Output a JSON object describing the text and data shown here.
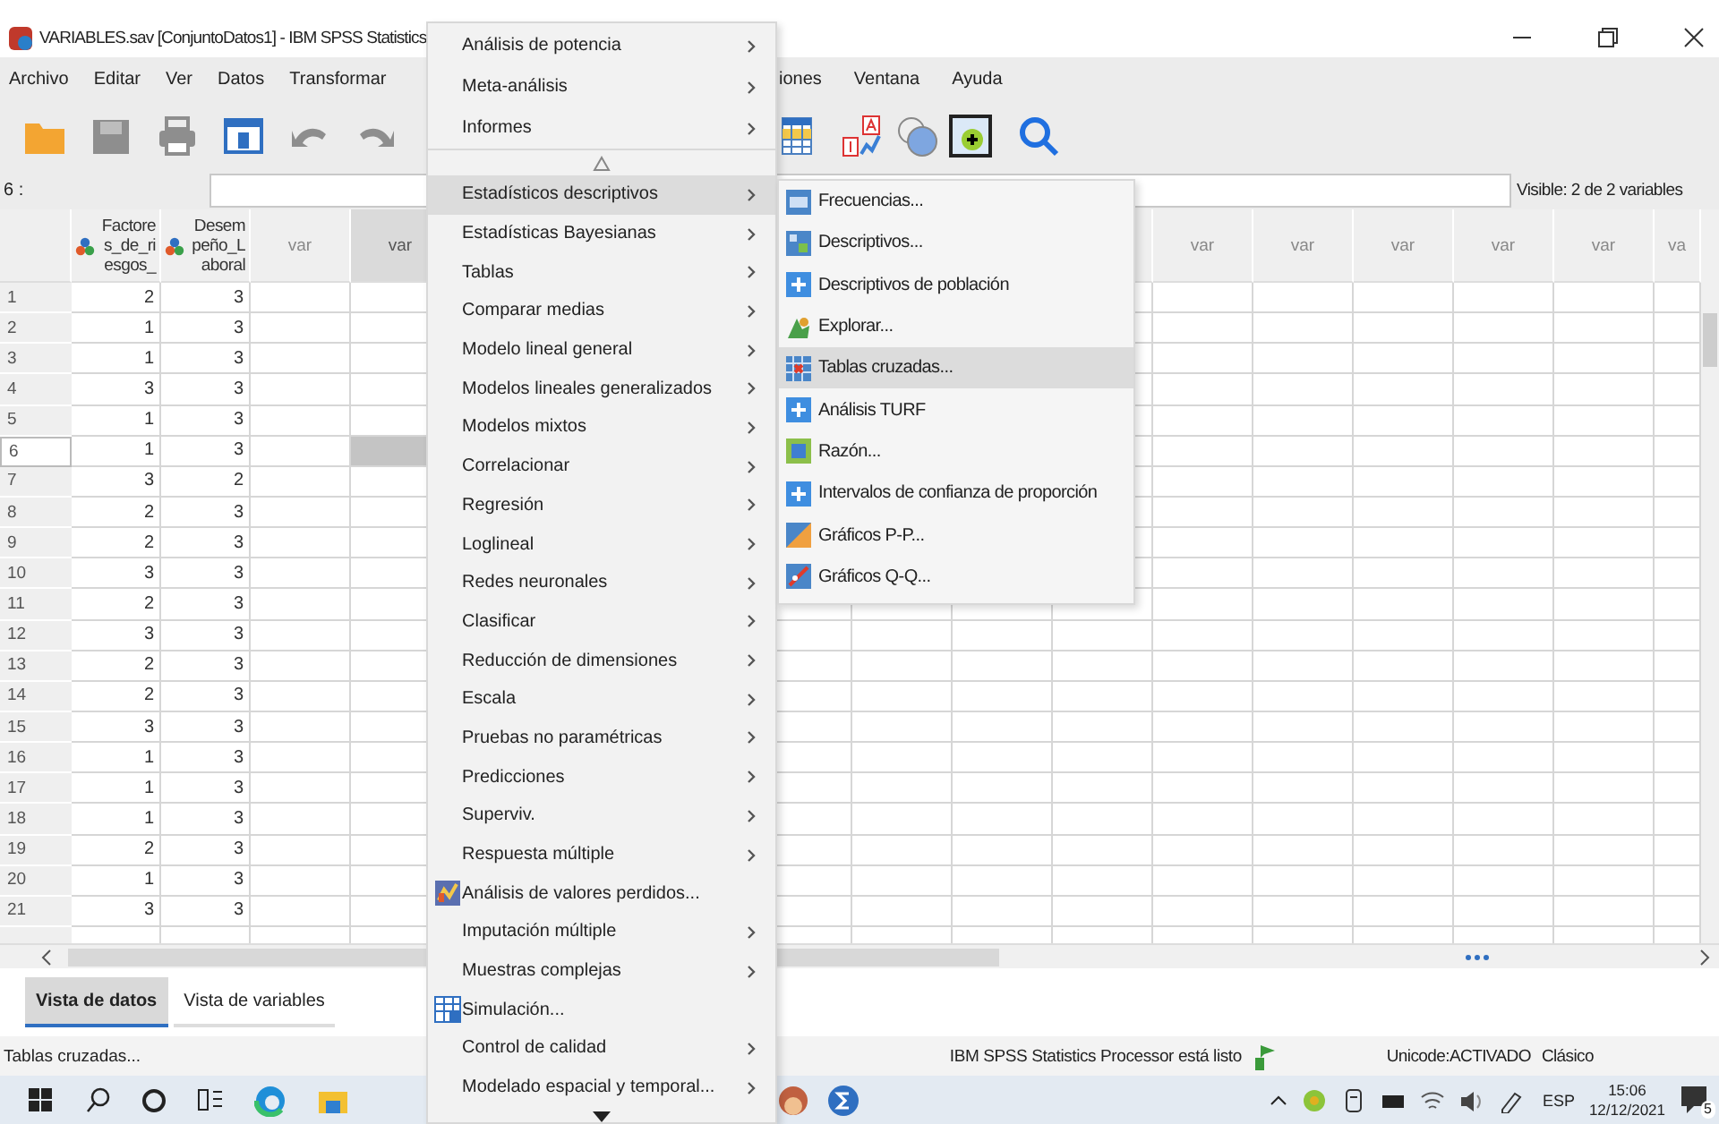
{
  "window": {
    "title": "VARIABLES.sav [ConjuntoDatos1] - IBM SPSS Statistics"
  },
  "menu_bar": {
    "left": [
      "Archivo",
      "Editar",
      "Ver",
      "Datos",
      "Transformar"
    ],
    "right": [
      "iones",
      "Ventana",
      "Ayuda"
    ]
  },
  "cell_editor": {
    "reference": "6 :",
    "visible": "Visible: 2 de 2 variables"
  },
  "table": {
    "columns": [
      {
        "label": "Factores_de_riesgos_",
        "kind": "nominal",
        "selected": false
      },
      {
        "label": "Desempeño_Laboral",
        "kind": "nominal",
        "selected": false
      },
      {
        "label": "var",
        "kind": "empty",
        "selected": false
      },
      {
        "label": "var",
        "kind": "empty",
        "selected": true
      },
      {
        "kind": "empty"
      },
      {
        "kind": "empty"
      },
      {
        "kind": "empty"
      },
      {
        "kind": "empty"
      },
      {
        "kind": "empty"
      },
      {
        "kind": "empty"
      },
      {
        "kind": "empty"
      },
      {
        "label": "var",
        "kind": "empty",
        "selected": false
      },
      {
        "label": "var",
        "kind": "empty",
        "selected": false
      },
      {
        "label": "var",
        "kind": "empty",
        "selected": false
      },
      {
        "label": "var",
        "kind": "empty",
        "selected": false
      },
      {
        "label": "var",
        "kind": "empty",
        "selected": false
      },
      {
        "label": "va",
        "kind": "empty",
        "selected": false
      }
    ],
    "rows": [
      {
        "number": "1",
        "values": [
          "2",
          "3"
        ],
        "selected": false
      },
      {
        "number": "2",
        "values": [
          "1",
          "3"
        ],
        "selected": false
      },
      {
        "number": "3",
        "values": [
          "1",
          "3"
        ],
        "selected": false
      },
      {
        "number": "4",
        "values": [
          "3",
          "3"
        ],
        "selected": false
      },
      {
        "number": "5",
        "values": [
          "1",
          "3"
        ],
        "selected": false
      },
      {
        "number": "6",
        "values": [
          "1",
          "3"
        ],
        "selected": true
      },
      {
        "number": "7",
        "values": [
          "3",
          "2"
        ],
        "selected": false
      },
      {
        "number": "8",
        "values": [
          "2",
          "3"
        ],
        "selected": false
      },
      {
        "number": "9",
        "values": [
          "2",
          "3"
        ],
        "selected": false
      },
      {
        "number": "10",
        "values": [
          "3",
          "3"
        ],
        "selected": false
      },
      {
        "number": "11",
        "values": [
          "2",
          "3"
        ],
        "selected": false
      },
      {
        "number": "12",
        "values": [
          "3",
          "3"
        ],
        "selected": false
      },
      {
        "number": "13",
        "values": [
          "2",
          "3"
        ],
        "selected": false
      },
      {
        "number": "14",
        "values": [
          "2",
          "3"
        ],
        "selected": false
      },
      {
        "number": "15",
        "values": [
          "3",
          "3"
        ],
        "selected": false
      },
      {
        "number": "16",
        "values": [
          "1",
          "3"
        ],
        "selected": false
      },
      {
        "number": "17",
        "values": [
          "1",
          "3"
        ],
        "selected": false
      },
      {
        "number": "18",
        "values": [
          "1",
          "3"
        ],
        "selected": false
      },
      {
        "number": "19",
        "values": [
          "2",
          "3"
        ],
        "selected": false
      },
      {
        "number": "20",
        "values": [
          "1",
          "3"
        ],
        "selected": false
      },
      {
        "number": "21",
        "values": [
          "3",
          "3"
        ],
        "selected": false
      }
    ]
  },
  "view_tabs": [
    {
      "label": "Vista de datos",
      "selected": true
    },
    {
      "label": "Vista de variables",
      "selected": false
    }
  ],
  "status_bar": {
    "message": "Tablas cruzadas...",
    "processor": "IBM SPSS Statistics Processor está listo",
    "encoding": "Unicode:ACTIVADO",
    "mode": "Clásico"
  },
  "menu": {
    "items": [
      {
        "label": "Análisis de potencia",
        "kind": "submenu",
        "selected": false
      },
      {
        "label": "Meta-análisis",
        "kind": "submenu",
        "selected": false
      },
      {
        "label": "Informes",
        "kind": "submenu",
        "selected": false
      },
      {
        "kind": "scroll-up",
        "selected": false
      },
      {
        "label": "Estadísticos descriptivos",
        "kind": "submenu",
        "selected": true
      },
      {
        "label": "Estadísticas Bayesianas",
        "kind": "submenu",
        "selected": false
      },
      {
        "label": "Tablas",
        "kind": "submenu",
        "selected": false
      },
      {
        "label": "Comparar medias",
        "kind": "submenu",
        "selected": false
      },
      {
        "label": "Modelo lineal general",
        "kind": "submenu",
        "selected": false
      },
      {
        "label": "Modelos lineales generalizados",
        "kind": "submenu",
        "selected": false
      },
      {
        "label": "Modelos mixtos",
        "kind": "submenu",
        "selected": false
      },
      {
        "label": "Correlacionar",
        "kind": "submenu",
        "selected": false
      },
      {
        "label": "Regresión",
        "kind": "submenu",
        "selected": false
      },
      {
        "label": "Loglineal",
        "kind": "submenu",
        "selected": false
      },
      {
        "label": "Redes neuronales",
        "kind": "submenu",
        "selected": false
      },
      {
        "label": "Clasificar",
        "kind": "submenu",
        "selected": false
      },
      {
        "label": "Reducción de dimensiones",
        "kind": "submenu",
        "selected": false
      },
      {
        "label": "Escala",
        "kind": "submenu",
        "selected": false
      },
      {
        "label": "Pruebas no paramétricas",
        "kind": "submenu",
        "selected": false
      },
      {
        "label": "Predicciones",
        "kind": "submenu",
        "selected": false
      },
      {
        "label": "Superviv.",
        "kind": "submenu",
        "selected": false
      },
      {
        "label": "Respuesta múltiple",
        "kind": "submenu",
        "selected": false
      },
      {
        "label": "Análisis de valores perdidos...",
        "kind": "dialog",
        "selected": false
      },
      {
        "label": "Imputación múltiple",
        "kind": "submenu",
        "selected": false
      },
      {
        "label": "Muestras complejas",
        "kind": "submenu",
        "selected": false
      },
      {
        "label": "Simulación...",
        "kind": "simulation",
        "selected": false
      },
      {
        "label": "Control de calidad",
        "kind": "submenu",
        "selected": false
      },
      {
        "label": "Modelado espacial y temporal...",
        "kind": "submenu",
        "selected": false
      },
      {
        "kind": "scroll-down",
        "selected": false
      }
    ]
  },
  "submenu": {
    "items": [
      {
        "label": "Frecuencias...",
        "kind": "frequencies",
        "selected": false
      },
      {
        "label": "Descriptivos...",
        "kind": "descriptives",
        "selected": false
      },
      {
        "label": "Descriptivos de población",
        "kind": "plus",
        "selected": false
      },
      {
        "label": "Explorar...",
        "kind": "explore",
        "selected": false
      },
      {
        "label": "Tablas cruzadas...",
        "kind": "crosstabs",
        "selected": true
      },
      {
        "label": "Análisis TURF",
        "kind": "plus",
        "selected": false
      },
      {
        "label": "Razón...",
        "kind": "ratio",
        "selected": false
      },
      {
        "label": "Intervalos de confianza de proporción",
        "kind": "plus",
        "selected": false
      },
      {
        "label": "Gráficos P-P...",
        "kind": "ppplot",
        "selected": false
      },
      {
        "label": "Gráficos Q-Q...",
        "kind": "qqplot",
        "selected": false
      }
    ]
  },
  "taskbar": {
    "language": "ESP",
    "time": "15:06",
    "date": "12/12/2021",
    "notifications": "5"
  }
}
